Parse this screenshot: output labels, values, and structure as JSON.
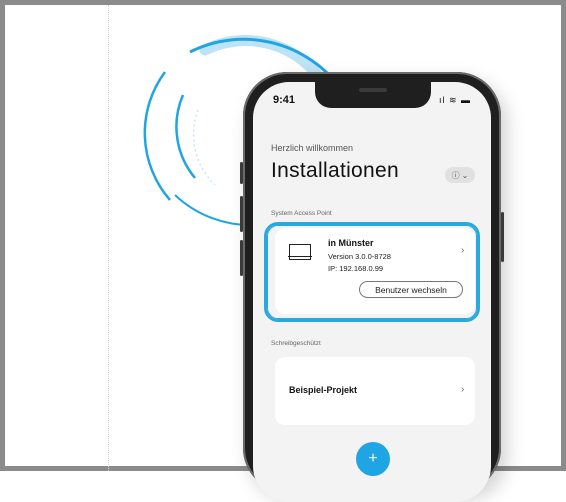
{
  "status_bar": {
    "time": "9:41",
    "icons": "ıl ≋ ▬"
  },
  "header": {
    "welcome": "Herzlich willkommen",
    "title": "Installationen",
    "help_icon": "info-circle",
    "help_chevron": "⌄"
  },
  "sections": {
    "access_point_label": "System Access Point",
    "write_protected_label": "Schreibgeschützt"
  },
  "access_point_card": {
    "name": "in Münster",
    "version": "Version 3.0.0-8728",
    "ip": "IP: 192.168.0.99",
    "switch_user_label": "Benutzer wechseln",
    "chevron": "›"
  },
  "project_card": {
    "name": "Beispiel-Projekt",
    "chevron": "›"
  },
  "fab": {
    "label": "+"
  },
  "colors": {
    "accent": "#1fa4e4",
    "highlight": "#29a9e0",
    "arc_light": "#bfe3f6"
  }
}
